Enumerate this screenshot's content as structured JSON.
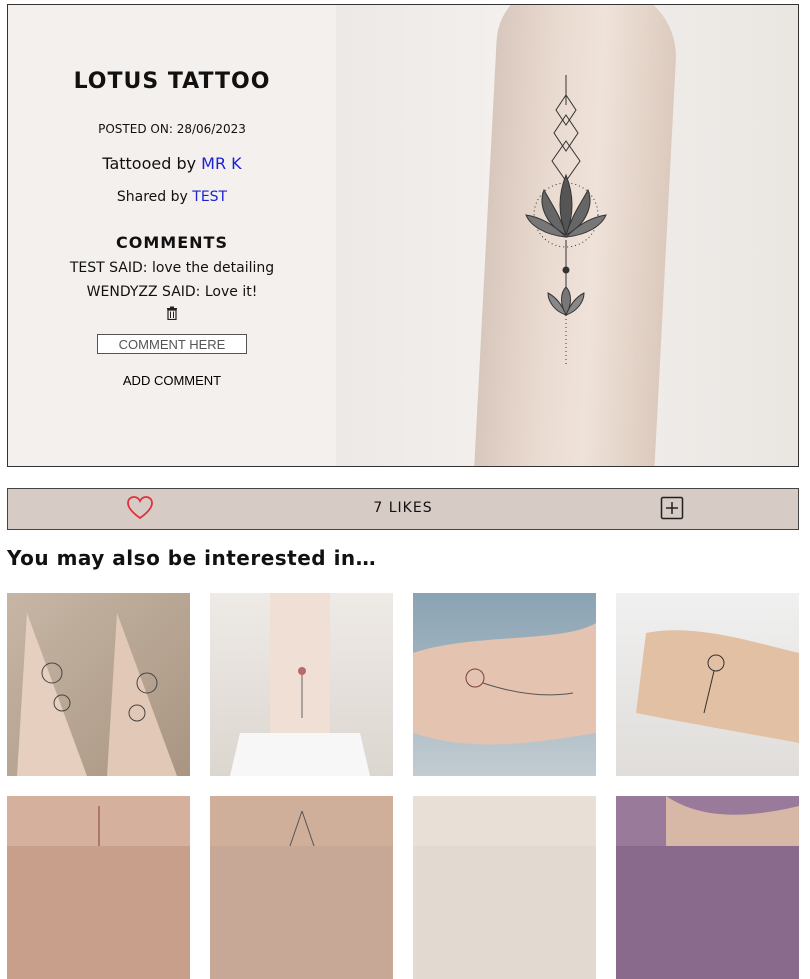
{
  "post": {
    "title": "LOTUS TATTOO",
    "posted_label": "POSTED ON:",
    "posted_date": "28/06/2023",
    "tattooed_label": "Tattooed by",
    "artist": "MR K",
    "shared_label": "Shared by",
    "sharer": "TEST",
    "comments_heading": "COMMENTS",
    "comments": [
      {
        "author": "TEST",
        "text": "love the detailing"
      },
      {
        "author": "WENDYZZ",
        "text": "Love it!"
      }
    ],
    "said": "SAID:",
    "comment_placeholder": "COMMENT HERE",
    "add_comment_label": "ADD COMMENT"
  },
  "actions": {
    "likes_label": "7 LIKES",
    "heart_color": "#e0313c"
  },
  "recommendations": {
    "heading": "You may also be interested in…",
    "items": [
      {
        "name": "floral-sleeve-tattoo"
      },
      {
        "name": "ankle-flower-tattoo"
      },
      {
        "name": "rose-forearm-tattoo"
      },
      {
        "name": "rose-arm-tattoo"
      },
      {
        "name": "spine-tattoo"
      },
      {
        "name": "back-floral-tattoo"
      },
      {
        "name": "shoulder-tattoo"
      },
      {
        "name": "purple-tattoo"
      }
    ]
  }
}
